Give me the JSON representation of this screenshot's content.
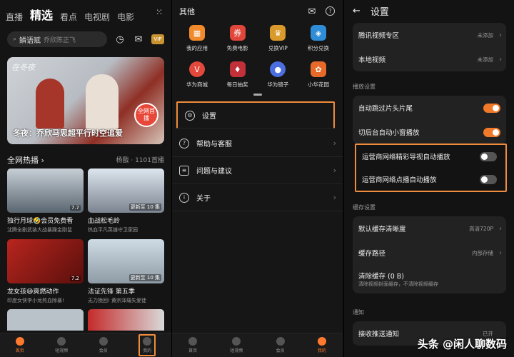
{
  "panel1": {
    "tabs": [
      "直播",
      "精选",
      "看点",
      "电视剧",
      "电影"
    ],
    "active_tab": "精选",
    "search": {
      "highlight": "鳞语赋",
      "placeholder": "乔欣陈正飞"
    },
    "banner": {
      "caption": "冬夜：乔欣马思超平行时空追爱",
      "badge": "全网首播",
      "art_text": "在冬夜"
    },
    "section": {
      "title": "全网热播",
      "right": "杨戬 · 1101首播"
    },
    "cards": [
      {
        "title": "独行月球🤣会员免费看",
        "sub": "沈腾全剧武装大战暴躁金刚鼠",
        "badge": "7.7"
      },
      {
        "title": "血战松毛岭",
        "sub": "热血平凡英雄守卫家园",
        "badge": "更新至 10 集"
      },
      {
        "title": "龙女孩😅爽燃动作",
        "sub": "印度女侠李小龙热血除暴!",
        "badge": "7.2"
      },
      {
        "title": "法证先锋 第五季",
        "sub": "无力挽回! 黄宗泽痛失爱徒",
        "badge": "更新至 10 集"
      }
    ],
    "nav": [
      "首页",
      "短视频",
      "会员",
      "我的"
    ]
  },
  "panel2": {
    "title": "其他",
    "grid_row1": [
      "我的应用",
      "免费电影",
      "兑换VIP",
      "积分兑换"
    ],
    "grid_row2": [
      "华为商城",
      "每日抽奖",
      "华为镜子",
      "小华花园"
    ],
    "menu": [
      "设置",
      "帮助与客服",
      "问题与建议",
      "关于"
    ],
    "nav": [
      "首页",
      "短视频",
      "会员",
      "我的"
    ]
  },
  "panel3": {
    "title": "设置",
    "top_rows": [
      {
        "label": "腾讯视频专区",
        "value": "未添加"
      },
      {
        "label": "本地视频",
        "value": "未添加"
      }
    ],
    "play_label": "播放设置",
    "play_rows": [
      {
        "label": "自动跳过片头片尾",
        "on": true
      },
      {
        "label": "切后台自动小窗播放",
        "on": true
      },
      {
        "label": "运营商网络精彩导视自动播放",
        "on": false
      },
      {
        "label": "运营商网络点播自动播放",
        "on": false
      }
    ],
    "cache_label": "缓存设置",
    "cache_rows": [
      {
        "label": "默认缓存清晰度",
        "value": "高清720P"
      },
      {
        "label": "缓存路径",
        "value": "内部存储"
      },
      {
        "label": "清除缓存 (0 B)",
        "sub": "清除视频封面缓存，不清除视频缓存"
      }
    ],
    "notify_label": "通知",
    "notify_row": {
      "label": "接收推送通知",
      "value": "已开"
    },
    "watermark": "头条 @闲人聊数码"
  },
  "colors": {
    "accent": "#f07a2a",
    "highlight_box": "#f08c3c"
  }
}
